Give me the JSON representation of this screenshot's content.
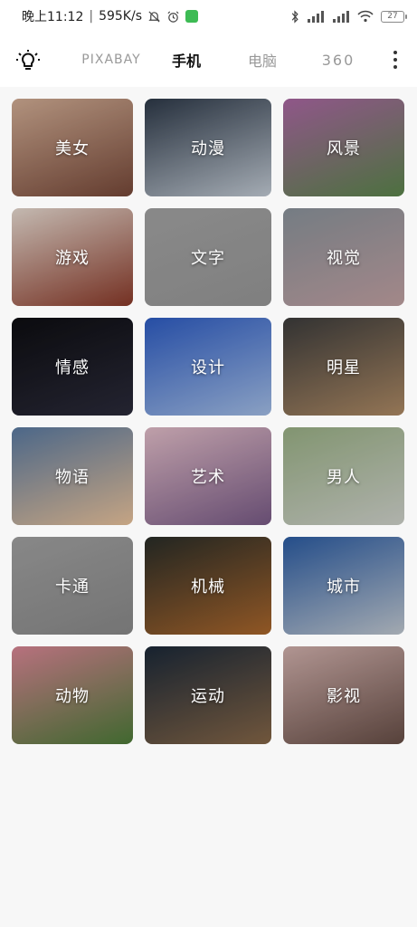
{
  "status": {
    "time": "晚上11:12",
    "net_speed": "595K/s",
    "battery": "27"
  },
  "tabs": [
    {
      "label": "PIXABAY",
      "active": false
    },
    {
      "label": "手机",
      "active": true
    },
    {
      "label": "电脑",
      "active": false
    },
    {
      "label": "360",
      "active": false
    }
  ],
  "icons": {
    "bulb": "lightbulb-icon",
    "more": "more-vertical-icon"
  },
  "categories": [
    {
      "label": "美女",
      "colors": [
        "#d9b39a",
        "#7a4a3a"
      ]
    },
    {
      "label": "动漫",
      "colors": [
        "#2e3a4a",
        "#c9d2dc"
      ]
    },
    {
      "label": "风景",
      "colors": [
        "#b06aa8",
        "#5e8a4e"
      ]
    },
    {
      "label": "游戏",
      "colors": [
        "#efe2d8",
        "#8e3b2a"
      ]
    },
    {
      "label": "文字",
      "colors": [
        "#a8a8a8",
        "#9c9c9c"
      ]
    },
    {
      "label": "视觉",
      "colors": [
        "#8f98a0",
        "#c7a6a8"
      ]
    },
    {
      "label": "情感",
      "colors": [
        "#0e0e12",
        "#2c2c3c"
      ]
    },
    {
      "label": "设计",
      "colors": [
        "#2f5fc9",
        "#a9c4ee"
      ]
    },
    {
      "label": "明星",
      "colors": [
        "#3e3e3e",
        "#b48f68"
      ]
    },
    {
      "label": "物语",
      "colors": [
        "#5d7ea6",
        "#f1c9a0"
      ]
    },
    {
      "label": "艺术",
      "colors": [
        "#e9c3cf",
        "#7c5d8a"
      ]
    },
    {
      "label": "男人",
      "colors": [
        "#9fb68a",
        "#d6d9d2"
      ]
    },
    {
      "label": "卡通",
      "colors": [
        "#a6a6a6",
        "#8e8e8e"
      ]
    },
    {
      "label": "机械",
      "colors": [
        "#2a2e2a",
        "#b06a2c"
      ]
    },
    {
      "label": "城市",
      "colors": [
        "#2d5fa8",
        "#c7cfd8"
      ]
    },
    {
      "label": "动物",
      "colors": [
        "#e08a9a",
        "#4f7f3a"
      ]
    },
    {
      "label": "运动",
      "colors": [
        "#1c2a3a",
        "#8a6a4a"
      ]
    },
    {
      "label": "影视",
      "colors": [
        "#d8b6b2",
        "#6a5048"
      ]
    }
  ]
}
